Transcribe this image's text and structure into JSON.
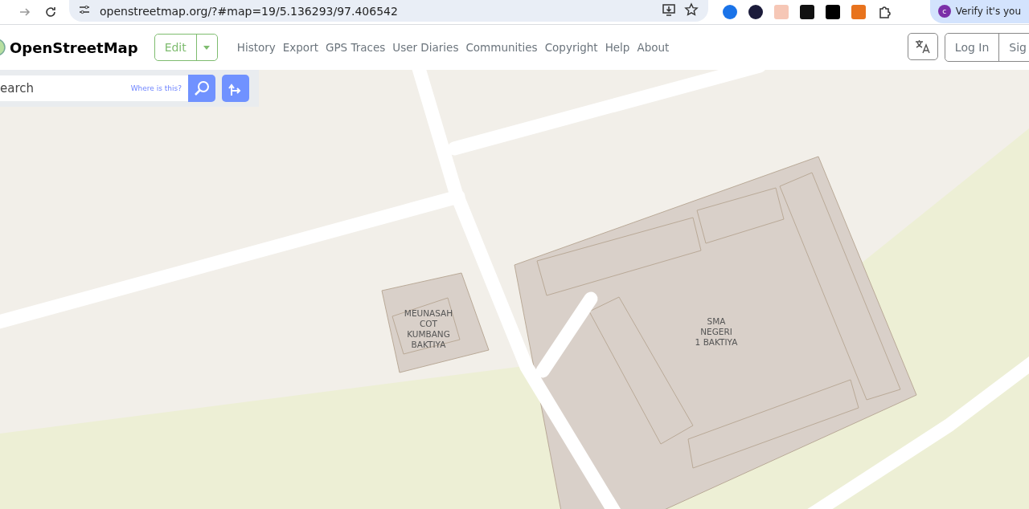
{
  "browser": {
    "url": "openstreetmap.org/?#map=19/5.136293/97.406542",
    "profile_label": "Verify it's you",
    "profile_initial": "c"
  },
  "header": {
    "brand": "OpenStreetMap",
    "edit_button": "Edit",
    "nav": [
      "History",
      "Export",
      "GPS Traces",
      "User Diaries",
      "Communities",
      "Copyright",
      "Help",
      "About"
    ],
    "login": "Log In",
    "signup": "Sig"
  },
  "search": {
    "placeholder": "earch",
    "where_link": "Where is this?"
  },
  "map": {
    "labels": [
      {
        "lines": [
          "MEUNASAH",
          "COT",
          "KUMBANG",
          "BAKTIYA"
        ]
      },
      {
        "lines": [
          "SMA",
          "NEGERI",
          "1 BAKTIYA"
        ]
      }
    ]
  }
}
